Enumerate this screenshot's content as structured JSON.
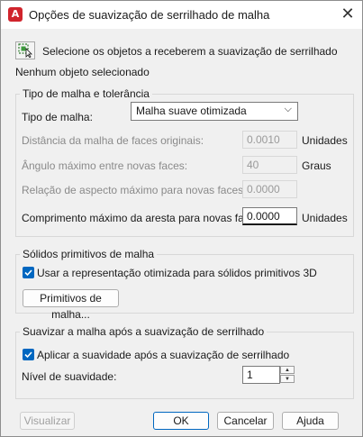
{
  "window": {
    "title": "Opções de suavização de serrilhado de malha",
    "app_icon": "A"
  },
  "select_objects": {
    "label": "Selecione os objetos a receberem a suavização de serrilhado",
    "status": "Nenhum objeto selecionado"
  },
  "mesh_type_group": {
    "title": "Tipo de malha e tolerância",
    "mesh_type_label": "Tipo de malha:",
    "mesh_type_value": "Malha suave otimizada",
    "distance_label": "Distância da malha de faces originais:",
    "distance_value": "0.0010",
    "distance_unit": "Unidades",
    "angle_label": "Ângulo máximo entre novas faces:",
    "angle_value": "40",
    "angle_unit": "Graus",
    "aspect_label": "Relação de aspecto máximo para novas faces:",
    "aspect_value": "0.0000",
    "edge_label": "Comprimento máximo da aresta para novas faces:",
    "edge_value": "0.0000",
    "edge_unit": "Unidades"
  },
  "primitives_group": {
    "title": "Sólidos primitivos de malha",
    "checkbox_label": "Usar a representação otimizada para sólidos primitivos 3D",
    "button_label": "Primitivos de malha..."
  },
  "smooth_group": {
    "title": "Suavizar a malha após a suavização de serrilhado",
    "checkbox_label": "Aplicar a suavidade após a suavização de serrilhado",
    "level_label": "Nível de suavidade:",
    "level_value": "1"
  },
  "footer": {
    "preview": "Visualizar",
    "ok": "OK",
    "cancel": "Cancelar",
    "help": "Ajuda"
  },
  "colors": {
    "accent": "#0067c0",
    "app_icon": "#d0242c"
  }
}
